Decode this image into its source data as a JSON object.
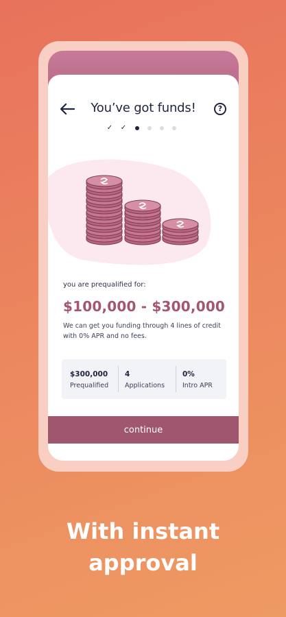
{
  "screen": {
    "title": "You’ve got funds!",
    "help_glyph": "?",
    "steps": [
      "✓",
      "✓"
    ]
  },
  "offer": {
    "prequal_label": "you are prequalified for:",
    "range": "$100,000 - $300,000",
    "description": "We can get you funding through 4 lines of credit with 0% APR and no fees."
  },
  "stats": [
    {
      "value": "$300,000",
      "label": "Prequalified"
    },
    {
      "value": "4",
      "label": "Applications"
    },
    {
      "value": "0%",
      "label": "Intro APR"
    }
  ],
  "actions": {
    "continue_label": "continue"
  },
  "promo": {
    "headline_line1": "With instant",
    "headline_line2": "approval"
  },
  "colors": {
    "background_start": "#e8725c",
    "background_end": "#ee9a63",
    "primary": "#a0566f",
    "coin": "#c7778f",
    "text_dark": "#1e2440"
  },
  "icons": {
    "back": "back-arrow-icon",
    "help": "help-icon",
    "coins": "coin-stack-illustration"
  }
}
